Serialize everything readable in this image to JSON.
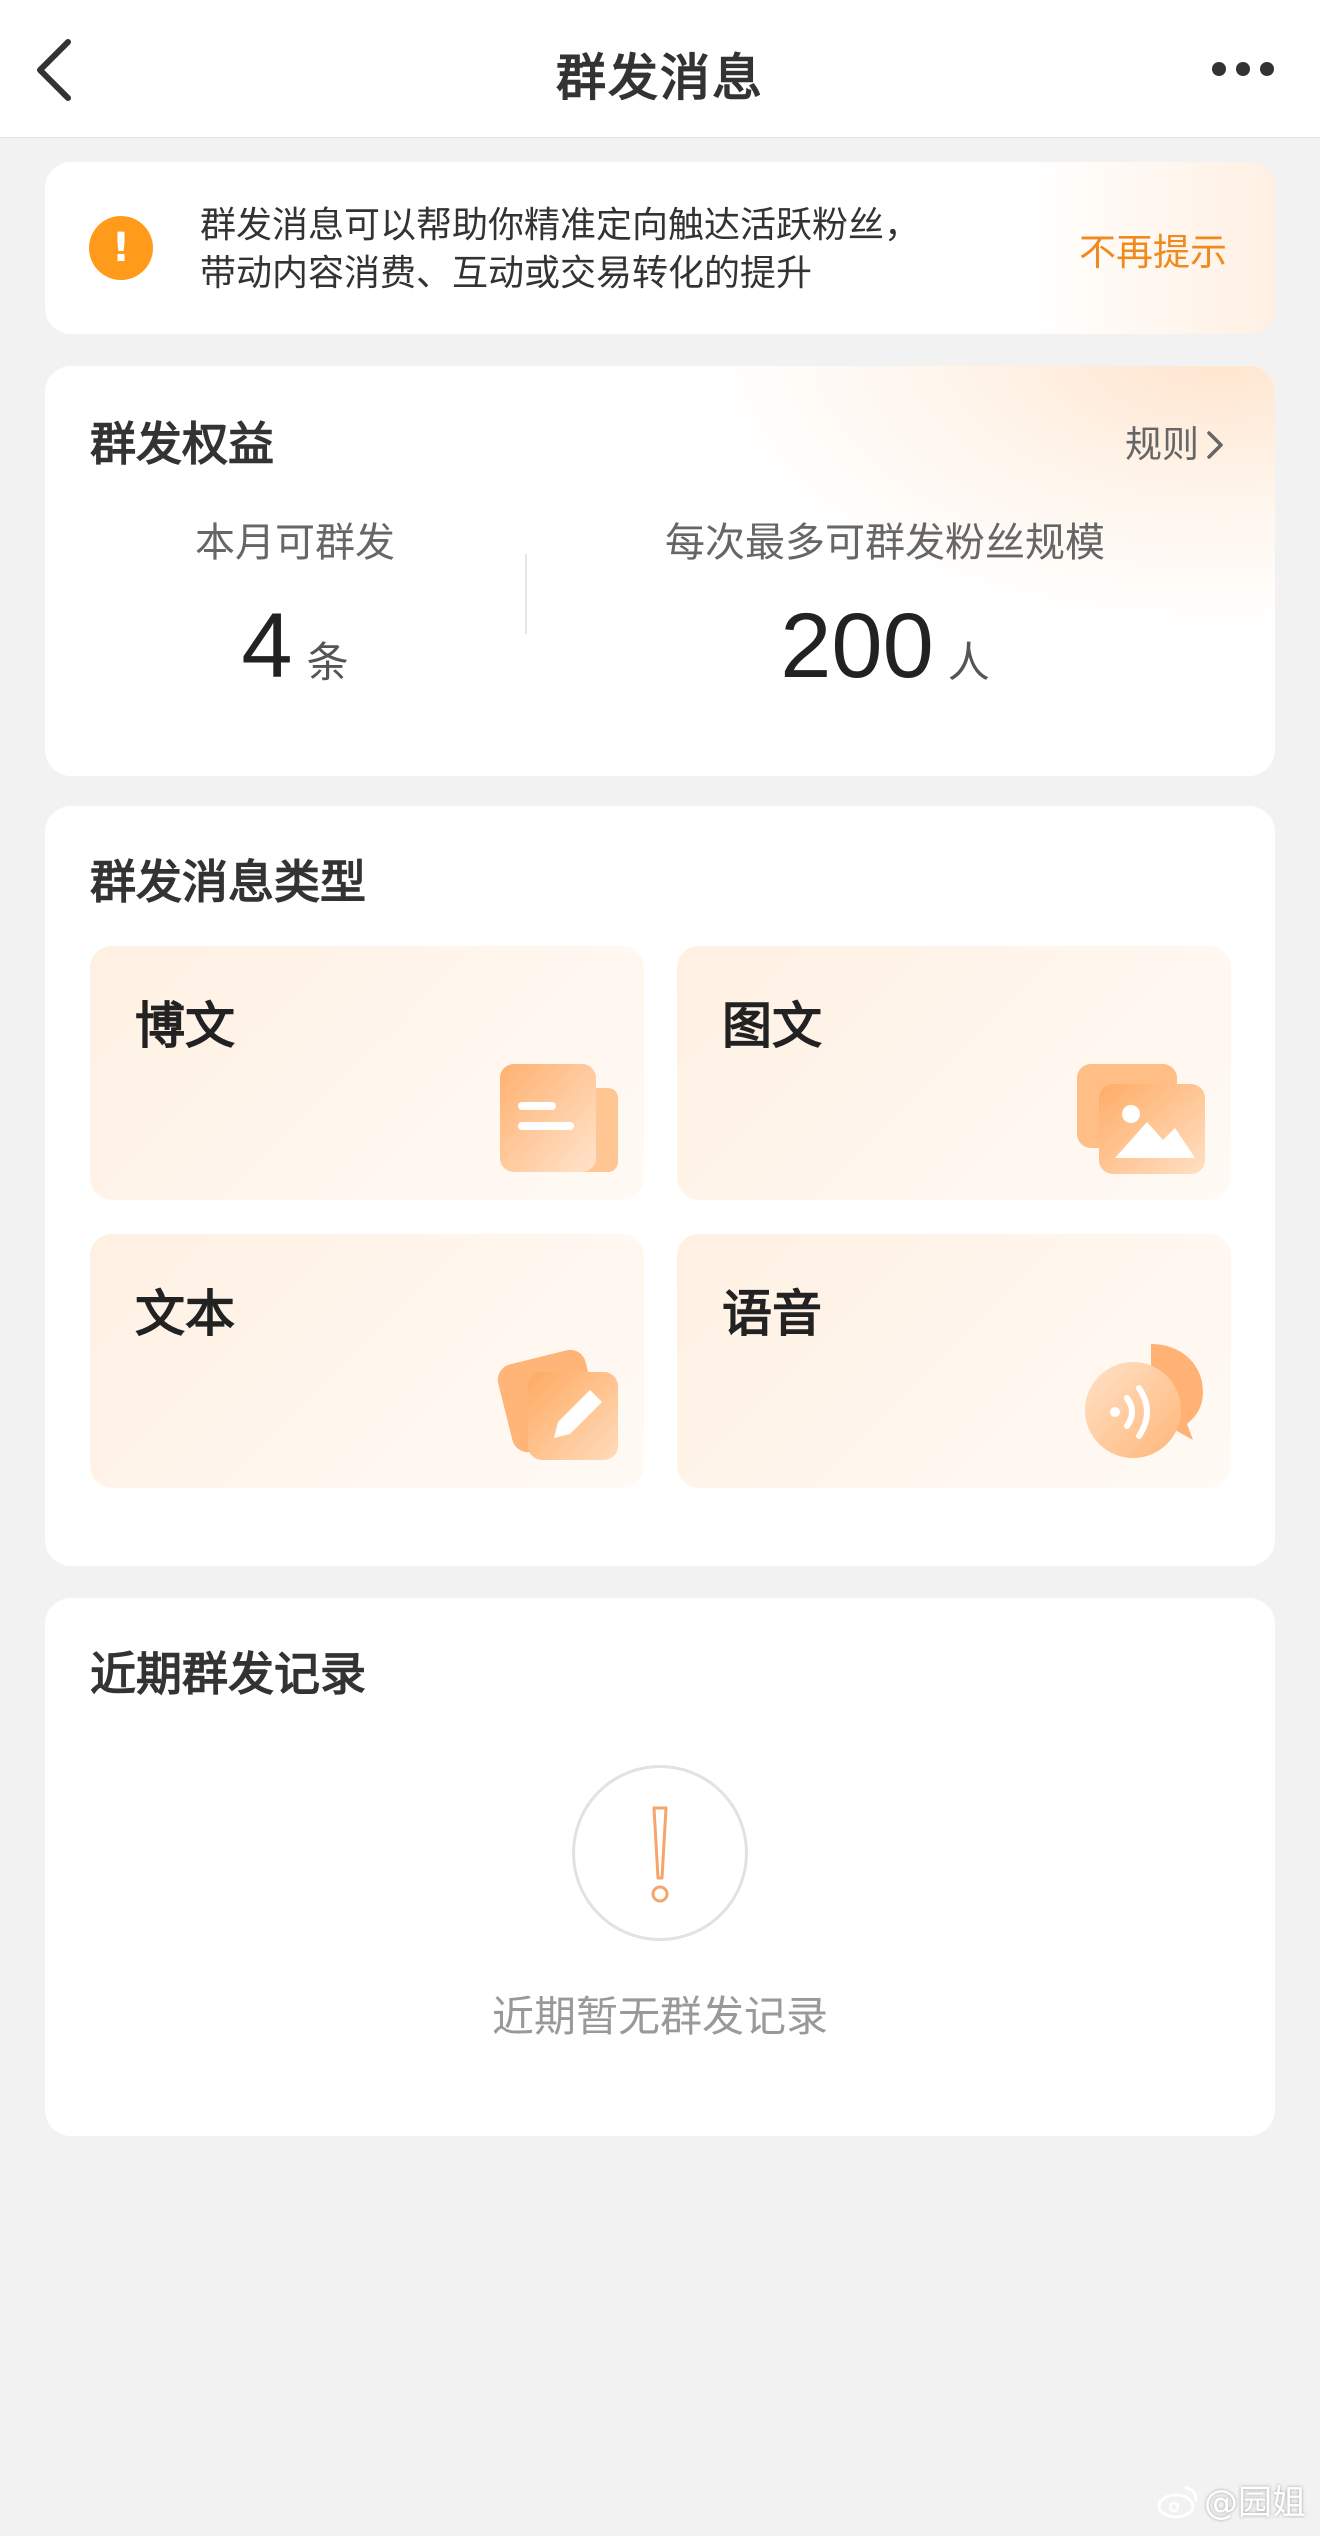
{
  "header": {
    "title": "群发消息",
    "back_icon": "chevron-left-icon",
    "more_icon": "more-horizontal-icon"
  },
  "tip": {
    "line1": "群发消息可以帮助你精准定向触达活跃粉丝，",
    "line2": "带动内容消费、互动或交易转化的提升",
    "dismiss_label": "不再提示",
    "icon": "exclamation-circle-icon",
    "icon_glyph": "!"
  },
  "quota": {
    "title": "群发权益",
    "rules_label": "规则",
    "monthly_label": "本月可群发",
    "monthly_value": "4",
    "monthly_unit": "条",
    "scale_label": "每次最多可群发粉丝规模",
    "scale_value": "200",
    "scale_unit": "人"
  },
  "types": {
    "title": "群发消息类型",
    "items": [
      {
        "label": "博文",
        "icon": "article-icon"
      },
      {
        "label": "图文",
        "icon": "image-icon"
      },
      {
        "label": "文本",
        "icon": "edit-pencil-icon"
      },
      {
        "label": "语音",
        "icon": "voice-icon"
      }
    ]
  },
  "history": {
    "title": "近期群发记录",
    "empty_text": "近期暂无群发记录",
    "empty_icon": "exclamation-icon"
  },
  "watermark": {
    "text": "@园姐",
    "icon": "weibo-icon"
  },
  "colors": {
    "accent": "#f08a1e",
    "warning_icon": "#ff9a1a",
    "background": "#f2f2f2",
    "tile_background": "#fff3e8"
  }
}
